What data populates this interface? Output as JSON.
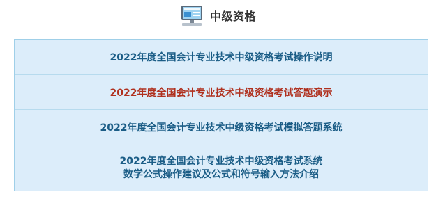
{
  "section": {
    "title": "中级资格",
    "icon": "computer-monitor-icon"
  },
  "colors": {
    "link": "#1b5d86",
    "active_link": "#b0311f",
    "panel_bg": "#dcedfa",
    "panel_border": "#9fcfe8"
  },
  "items": [
    {
      "label": "2022年度全国会计专业技术中级资格考试操作说明"
    },
    {
      "label": "2022年度全国会计专业技术中级资格考试答题演示"
    },
    {
      "label": "2022年度全国会计专业技术中级资格考试模拟答题系统"
    },
    {
      "line1": "2022年度全国会计专业技术中级资格考试系统",
      "line2": "数学公式操作建议及公式和符号输入方法介绍"
    }
  ]
}
